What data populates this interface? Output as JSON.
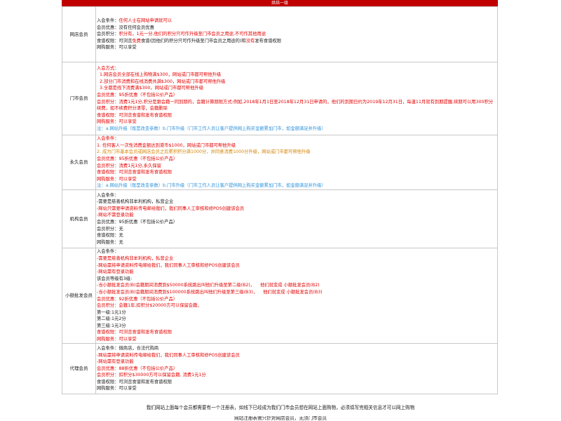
{
  "page": {
    "header_title": "烘焙一级",
    "header_color": "#c00000",
    "footer_note": "我们网站上面每个会员都需要有一个注册表，如线下已经成为我们门市会员想在网站上面购物，必须填写完相关信息才可以网上购物",
    "footer_note_2": "网站注册表需只针对网店会员，无须门市会员"
  },
  "rows": [
    {
      "label": "网店会员",
      "lines": [
        [
          {
            "t": "入会条件：",
            "c": "#1a1a1a"
          },
          {
            "t": "任何人士在网站申请就可以",
            "c": "#e60000"
          }
        ],
        [
          {
            "t": "会员优惠：没有任何会员优惠",
            "c": "#1a1a1a"
          }
        ],
        [
          {
            "t": "会员积分：",
            "c": "#1a1a1a"
          },
          {
            "t": "积分有，1元一分,他们的积分只可作升级至门市会员之用途,不可作其他用途",
            "c": "#e60000"
          }
        ],
        [
          {
            "t": "食谱权限：可浏览",
            "c": "#1a1a1a"
          },
          {
            "t": "免费",
            "c": "#e60000"
          },
          {
            "t": "食谱(因他们的积分只可作升级至门市会员之用途的)和",
            "c": "#1a1a1a"
          },
          {
            "t": "没有",
            "c": "#e60000"
          },
          {
            "t": "发布食谱权限",
            "c": "#1a1a1a"
          }
        ],
        [
          {
            "t": "网购服务：可以享受",
            "c": "#1a1a1a"
          }
        ]
      ]
    },
    {
      "label": "门市会员",
      "lines": [
        [
          {
            "t": "入会方式：",
            "c": "#e60000"
          }
        ],
        [
          {
            "t": "  1.网店会员全部在线上购物满$300，网站或门市都可帮他升级",
            "c": "#e60000"
          }
        ],
        [
          {
            "t": "  2.部分门市消费和在线消费共满$300，网站或门市都可帮他升级",
            "c": "#e60000"
          }
        ],
        [
          {
            "t": "  3.全都是线下消费满$300，网站或门市都可帮他升级",
            "c": "#e60000"
          }
        ],
        [
          {
            "t": "会员优惠：95折优惠（不包括公价产品）",
            "c": "#e60000"
          }
        ],
        [
          {
            "t": "会员积分：消费1元1分,积分是跟会籍一同到期的，会籍计算期限方式:例如,2018年1月1日至2018年12月31日申请的，他们的到期日约为2019年12月31日，每逢11月就有到期提醒,续期可以用300积分续费，如不续费积分清零，会籍删除",
            "c": "#e60000"
          }
        ],
        [
          {
            "t": "食谱权限：可浏览食谱和发布食谱权限",
            "c": "#e60000"
          }
        ],
        [
          {
            "t": "网购服务：可以享受",
            "c": "#e60000"
          }
        ],
        [
          {
            "t": "注：a.网站升级（既是改变参数）b.门市升级（门市工作人员让客户提供网上购买金额累加门市，如金额满足并升级）",
            "c": "#2f94dc"
          }
        ]
      ]
    },
    {
      "label": "永久会员",
      "lines": [
        [
          {
            "t": "入会条件：",
            "c": "#e60000"
          }
        ],
        [
          {
            "t": "1. 任何客人一次性消费金额达到港币$1000，网站或门市都可帮他升级",
            "c": "#e60000"
          }
        ],
        [
          {
            "t": "2. 成为门市基本会员或网店会员之后累积积分满1000分，并同意消费1000分升级，网站或门市都可帮他升级",
            "c": "#d4860b"
          }
        ],
        [
          {
            "t": "会员优惠：95折优惠（不包括公价产品）",
            "c": "#e60000"
          }
        ],
        [
          {
            "t": "会员积分：消费1元1分,永久保留",
            "c": "#e60000"
          }
        ],
        [
          {
            "t": "食谱权限：可浏览食谱和发布食谱权限",
            "c": "#e60000"
          }
        ],
        [
          {
            "t": "网购服务：可以享受",
            "c": "#e60000"
          }
        ],
        [
          {
            "t": "注：a.网站升级（既是改变参数）b.门市升级（门市工作人员让客户提供网上购买金额累加门市，如金额满足并升级）",
            "c": "#2f94dc"
          }
        ]
      ]
    },
    {
      "label": "机构会员",
      "lines": [
        [
          {
            "t": "入会条件：",
            "c": "#1a1a1a"
          }
        ],
        [
          {
            "t": "-需要是慈善机构非牟利机构，私营企业",
            "c": "#1a1a1a"
          }
        ],
        [
          {
            "t": "-网站只需要申请资料传电邮给我们，我们同事人工审核和修POS创建该会员",
            "c": "#e60000"
          }
        ],
        [
          {
            "t": "-网站不需登录功能",
            "c": "#e60000"
          }
        ],
        [
          {
            "t": "会员优惠：95折优惠（不包括公价产品）",
            "c": "#1a1a1a"
          }
        ],
        [
          {
            "t": "会员积分：无",
            "c": "#1a1a1a"
          }
        ],
        [
          {
            "t": "食谱权限：无",
            "c": "#1a1a1a"
          }
        ],
        [
          {
            "t": "网购服务：无",
            "c": "#1a1a1a"
          }
        ]
      ]
    },
    {
      "label": "小额批发会员",
      "lines": [
        [
          {
            "t": "入会条件：",
            "c": "#1a1a1a"
          }
        ],
        [
          {
            "t": "-需要是慈善机构非牟利机构，私营企业",
            "c": "#e60000"
          }
        ],
        [
          {
            "t": "-网站需将申请资料传电邮给我们，我们同事人工审核和修POS创建该会员",
            "c": "#e60000"
          }
        ],
        [
          {
            "t": "-网站需有登录功能",
            "c": "#e60000"
          }
        ],
        [
          {
            "t": "该会员等级有3级:",
            "c": "#1a1a1a"
          }
        ],
        [
          {
            "t": "-当小额批发会员(B)会籍期间消费到$50000系统跳出叫他们升级至第二级(B2)，    他们就变成 小额批发会员(B2)",
            "c": "#e60000"
          }
        ],
        [
          {
            "t": "-当小额批发会员(B)会籍期间消费到$100000系统跳出叫他们升级至第三级(B3)，    他们就变成 小额批发会员(B3)",
            "c": "#e60000"
          }
        ],
        [
          {
            "t": "会员优惠：92折优惠（不包括公价产品）",
            "c": "#e60000"
          }
        ],
        [
          {
            "t": "会员积分：会籍1年,扣积分$20000方可以保留会籍，",
            "c": "#e60000"
          }
        ],
        [
          {
            "t": "第一级:1元1分",
            "c": "#1a1a1a"
          }
        ],
        [
          {
            "t": "第二级:1元2分",
            "c": "#1a1a1a"
          }
        ],
        [
          {
            "t": "第三级:1元3分",
            "c": "#1a1a1a"
          }
        ],
        [
          {
            "t": "食谱权限：可浏览食谱和发布食谱权限",
            "c": "#e60000"
          }
        ],
        [
          {
            "t": "网购服务：可以享受",
            "c": "#e60000"
          }
        ]
      ]
    },
    {
      "label": "代理会员",
      "lines": [
        [
          {
            "t": "入会条件：微商店，合法代购商",
            "c": "#1a1a1a"
          }
        ],
        [
          {
            "t": "-网站需将申请资料传电邮给我们，我们同事人工审核和修POS创建该会员",
            "c": "#e60000"
          }
        ],
        [
          {
            "t": "-网站需有登录功能",
            "c": "#e60000"
          }
        ],
        [
          {
            "t": "会员优惠：88折优惠（不包括公价产品）",
            "c": "#e60000"
          }
        ],
        [
          {
            "t": "会员积分：扣积分$30000方可以保留会籍, 消费1元1分",
            "c": "#e60000"
          }
        ],
        [
          {
            "t": "食谱权限：可浏览食谱和发布食谱权限",
            "c": "#1a1a1a"
          }
        ],
        [
          {
            "t": "网购服务：可以享受",
            "c": "#1a1a1a"
          }
        ]
      ]
    }
  ]
}
